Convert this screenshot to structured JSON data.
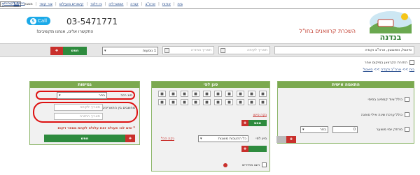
{
  "topnav": {
    "links": [
      "בית",
      "אודות",
      "ארה\"ב",
      "קנדה",
      "אוסטרליה",
      "ניו זילנד",
      "קישורים מועילים",
      "צור קשר",
      "מטבע"
    ],
    "currency": "ILS",
    "login": "כניסת לקוחות"
  },
  "header": {
    "logo_text": "בנדנה",
    "tagline": "השכרת קרוואנים בחו\"ל",
    "phone": "03-5471771",
    "phone_sub": "התקשרו אלינו, אנחנו מקשיבים!",
    "call_label": "Call"
  },
  "search": {
    "location_value": "סיאטל, וושינגטון, ארה\"ב וקנדה",
    "pickup_date_placeholder": "תאריך לקיחה",
    "return_date_placeholder": "תאריך החזרה",
    "passengers_value": "1 נוסעות",
    "search_button": "חפש",
    "return_elsewhere_label": "החזרת הקרוואן במיקום אחר"
  },
  "breadcrumb": [
    "בית",
    "ארה\"ב וקנדה",
    "סיאטל"
  ],
  "personal": {
    "title": "התאמה אישית",
    "opt1": "כולל ציוד קמפינג בסיסי",
    "opt2": "כולל ערכת שינה אילי סופגה",
    "mileage_label": "מרחק יומי משוער",
    "mileage_value": "0",
    "mileage_unit": "בחר"
  },
  "filter": {
    "title": "סנן לפי",
    "icons": [
      "wc",
      "wifi",
      "tv",
      "ac",
      "bike",
      "gen",
      "dog",
      "kid",
      "sun",
      "bed",
      "shower",
      "stove",
      "sat",
      "gps",
      "cd",
      "fan",
      "heat",
      "solar",
      "tent",
      "mic"
    ],
    "clear_link": "נקה סינון",
    "clear_btn": "אפס",
    "sort_label": "מיין לפי",
    "sort_value": "כל ההטבות מוצגות",
    "clear_all_link": "נקה הכל",
    "bottom_label": "הצג מחירים"
  },
  "flex": {
    "title": "גמישות",
    "vehicle_label": "סוג רכב",
    "vehicle_value": "בחר",
    "dates_label": "מחשבים בין התאריכים",
    "pickup_placeholder": "תאריך לקיחה",
    "return_placeholder": "תאריך החזרה",
    "note": "* שים לב: פעולה זאת עלולה לקחת מספר דקות",
    "button": "חפש"
  },
  "colors": {
    "green": "#7ba94f",
    "red": "#c9302c",
    "blue_link": "#2a4f8f",
    "call_blue": "#1ba9e8"
  }
}
